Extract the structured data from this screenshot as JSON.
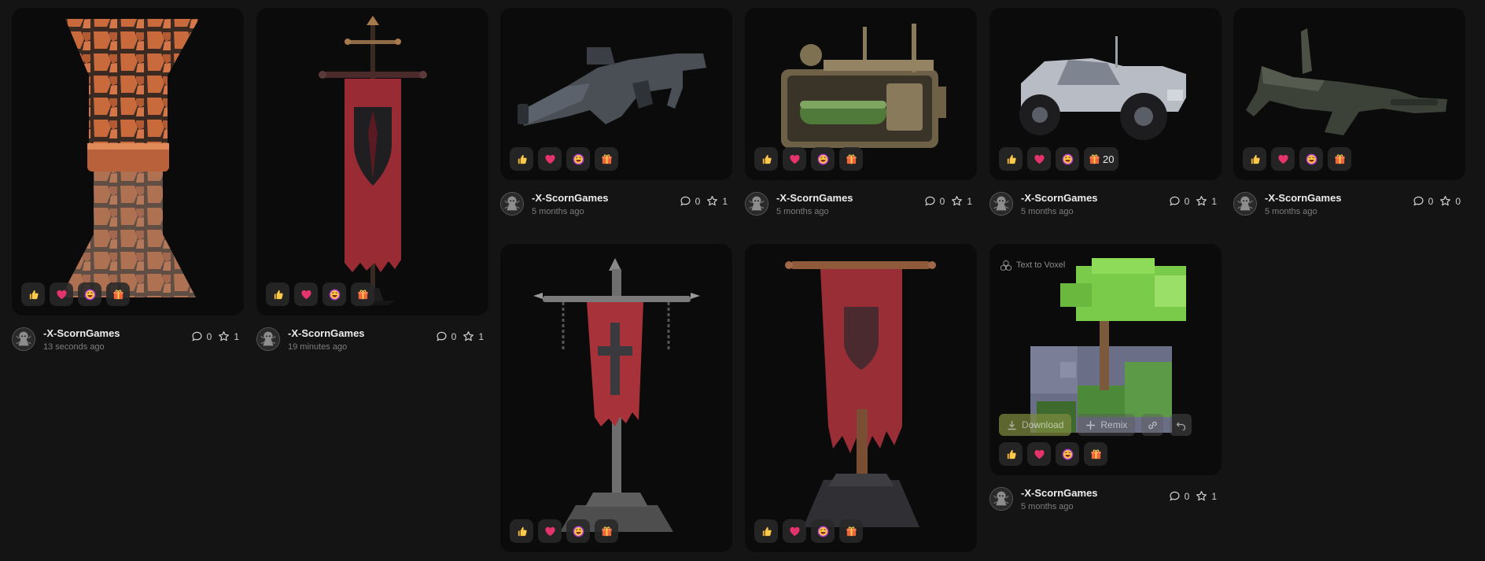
{
  "author": {
    "name": "-X-ScornGames"
  },
  "reactions": {
    "like": "like-icon",
    "heart": "heart-icon",
    "laugh": "laugh-icon",
    "gift": "gift-icon"
  },
  "colors": {
    "background": "#141414",
    "card": "#0b0b0b",
    "download_button": "#7d8a3e",
    "heart": "#e5336b",
    "gift": "#f0643c"
  },
  "cards": [
    {
      "id": "stone-pillar",
      "subject": "stone-pillar",
      "time": "13 seconds ago",
      "comments": "0",
      "stars": "1",
      "gift_count": ""
    },
    {
      "id": "red-banner-shield",
      "subject": "red-banner",
      "time": "19 minutes ago",
      "comments": "0",
      "stars": "1",
      "gift_count": ""
    },
    {
      "id": "grey-rifle",
      "subject": "grey-rifle",
      "time": "5 months ago",
      "comments": "0",
      "stars": "1",
      "gift_count": ""
    },
    {
      "id": "steam-machine",
      "subject": "steam-machine",
      "time": "5 months ago",
      "comments": "0",
      "stars": "1",
      "gift_count": ""
    },
    {
      "id": "silver-truck",
      "subject": "silver-truck",
      "time": "5 months ago",
      "comments": "0",
      "stars": "1",
      "gift_count": "20"
    },
    {
      "id": "dark-rifle",
      "subject": "dark-rifle",
      "time": "5 months ago",
      "comments": "0",
      "stars": "0",
      "gift_count": ""
    },
    {
      "id": "cross-banner-stand",
      "subject": "cross-banner-stand",
      "time": "",
      "comments": "",
      "stars": "",
      "gift_count": ""
    },
    {
      "id": "tattered-banner",
      "subject": "tattered-banner",
      "time": "",
      "comments": "",
      "stars": "",
      "gift_count": ""
    },
    {
      "id": "voxel-tree",
      "subject": "voxel-tree",
      "time": "5 months ago",
      "comments": "0",
      "stars": "1",
      "gift_count": "",
      "label": "Text to Voxel",
      "download_label": "Download",
      "remix_label": "Remix"
    }
  ]
}
